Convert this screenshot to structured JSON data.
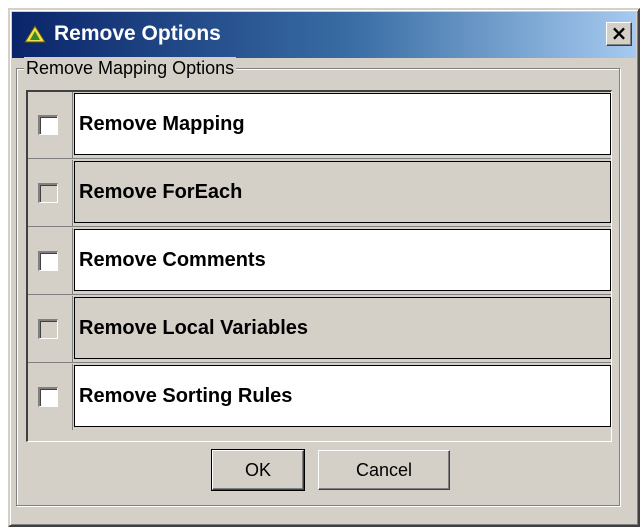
{
  "dialog": {
    "title": "Remove Options",
    "close_glyph": "×",
    "icon": "app-logo-icon"
  },
  "group": {
    "label": "Remove Mapping Options"
  },
  "options": [
    {
      "label": "Remove Mapping",
      "checked": false
    },
    {
      "label": "Remove ForEach",
      "checked": false
    },
    {
      "label": "Remove Comments",
      "checked": false
    },
    {
      "label": "Remove Local Variables",
      "checked": false
    },
    {
      "label": "Remove Sorting Rules",
      "checked": false
    }
  ],
  "buttons": {
    "ok": "OK",
    "cancel": "Cancel"
  }
}
